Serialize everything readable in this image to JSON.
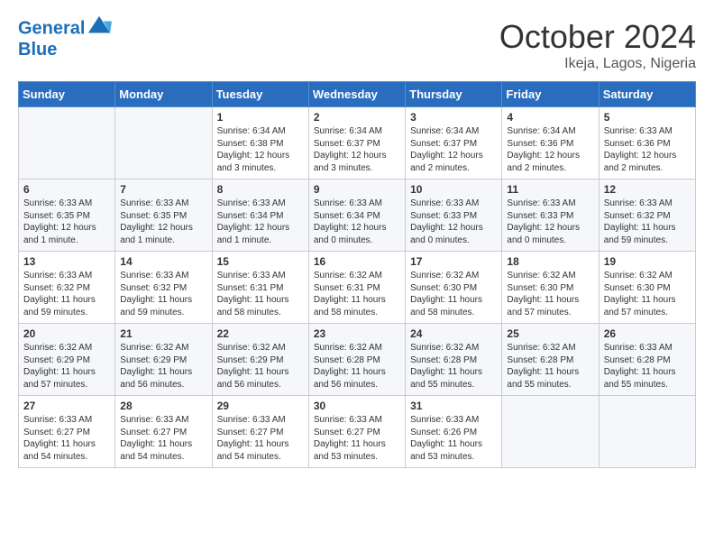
{
  "header": {
    "logo_line1": "General",
    "logo_line2": "Blue",
    "month": "October 2024",
    "location": "Ikeja, Lagos, Nigeria"
  },
  "days_of_week": [
    "Sunday",
    "Monday",
    "Tuesday",
    "Wednesday",
    "Thursday",
    "Friday",
    "Saturday"
  ],
  "weeks": [
    [
      {
        "day": "",
        "sunrise": "",
        "sunset": "",
        "daylight": ""
      },
      {
        "day": "",
        "sunrise": "",
        "sunset": "",
        "daylight": ""
      },
      {
        "day": "1",
        "sunrise": "Sunrise: 6:34 AM",
        "sunset": "Sunset: 6:38 PM",
        "daylight": "Daylight: 12 hours and 3 minutes."
      },
      {
        "day": "2",
        "sunrise": "Sunrise: 6:34 AM",
        "sunset": "Sunset: 6:37 PM",
        "daylight": "Daylight: 12 hours and 3 minutes."
      },
      {
        "day": "3",
        "sunrise": "Sunrise: 6:34 AM",
        "sunset": "Sunset: 6:37 PM",
        "daylight": "Daylight: 12 hours and 2 minutes."
      },
      {
        "day": "4",
        "sunrise": "Sunrise: 6:34 AM",
        "sunset": "Sunset: 6:36 PM",
        "daylight": "Daylight: 12 hours and 2 minutes."
      },
      {
        "day": "5",
        "sunrise": "Sunrise: 6:33 AM",
        "sunset": "Sunset: 6:36 PM",
        "daylight": "Daylight: 12 hours and 2 minutes."
      }
    ],
    [
      {
        "day": "6",
        "sunrise": "Sunrise: 6:33 AM",
        "sunset": "Sunset: 6:35 PM",
        "daylight": "Daylight: 12 hours and 1 minute."
      },
      {
        "day": "7",
        "sunrise": "Sunrise: 6:33 AM",
        "sunset": "Sunset: 6:35 PM",
        "daylight": "Daylight: 12 hours and 1 minute."
      },
      {
        "day": "8",
        "sunrise": "Sunrise: 6:33 AM",
        "sunset": "Sunset: 6:34 PM",
        "daylight": "Daylight: 12 hours and 1 minute."
      },
      {
        "day": "9",
        "sunrise": "Sunrise: 6:33 AM",
        "sunset": "Sunset: 6:34 PM",
        "daylight": "Daylight: 12 hours and 0 minutes."
      },
      {
        "day": "10",
        "sunrise": "Sunrise: 6:33 AM",
        "sunset": "Sunset: 6:33 PM",
        "daylight": "Daylight: 12 hours and 0 minutes."
      },
      {
        "day": "11",
        "sunrise": "Sunrise: 6:33 AM",
        "sunset": "Sunset: 6:33 PM",
        "daylight": "Daylight: 12 hours and 0 minutes."
      },
      {
        "day": "12",
        "sunrise": "Sunrise: 6:33 AM",
        "sunset": "Sunset: 6:32 PM",
        "daylight": "Daylight: 11 hours and 59 minutes."
      }
    ],
    [
      {
        "day": "13",
        "sunrise": "Sunrise: 6:33 AM",
        "sunset": "Sunset: 6:32 PM",
        "daylight": "Daylight: 11 hours and 59 minutes."
      },
      {
        "day": "14",
        "sunrise": "Sunrise: 6:33 AM",
        "sunset": "Sunset: 6:32 PM",
        "daylight": "Daylight: 11 hours and 59 minutes."
      },
      {
        "day": "15",
        "sunrise": "Sunrise: 6:33 AM",
        "sunset": "Sunset: 6:31 PM",
        "daylight": "Daylight: 11 hours and 58 minutes."
      },
      {
        "day": "16",
        "sunrise": "Sunrise: 6:32 AM",
        "sunset": "Sunset: 6:31 PM",
        "daylight": "Daylight: 11 hours and 58 minutes."
      },
      {
        "day": "17",
        "sunrise": "Sunrise: 6:32 AM",
        "sunset": "Sunset: 6:30 PM",
        "daylight": "Daylight: 11 hours and 58 minutes."
      },
      {
        "day": "18",
        "sunrise": "Sunrise: 6:32 AM",
        "sunset": "Sunset: 6:30 PM",
        "daylight": "Daylight: 11 hours and 57 minutes."
      },
      {
        "day": "19",
        "sunrise": "Sunrise: 6:32 AM",
        "sunset": "Sunset: 6:30 PM",
        "daylight": "Daylight: 11 hours and 57 minutes."
      }
    ],
    [
      {
        "day": "20",
        "sunrise": "Sunrise: 6:32 AM",
        "sunset": "Sunset: 6:29 PM",
        "daylight": "Daylight: 11 hours and 57 minutes."
      },
      {
        "day": "21",
        "sunrise": "Sunrise: 6:32 AM",
        "sunset": "Sunset: 6:29 PM",
        "daylight": "Daylight: 11 hours and 56 minutes."
      },
      {
        "day": "22",
        "sunrise": "Sunrise: 6:32 AM",
        "sunset": "Sunset: 6:29 PM",
        "daylight": "Daylight: 11 hours and 56 minutes."
      },
      {
        "day": "23",
        "sunrise": "Sunrise: 6:32 AM",
        "sunset": "Sunset: 6:28 PM",
        "daylight": "Daylight: 11 hours and 56 minutes."
      },
      {
        "day": "24",
        "sunrise": "Sunrise: 6:32 AM",
        "sunset": "Sunset: 6:28 PM",
        "daylight": "Daylight: 11 hours and 55 minutes."
      },
      {
        "day": "25",
        "sunrise": "Sunrise: 6:32 AM",
        "sunset": "Sunset: 6:28 PM",
        "daylight": "Daylight: 11 hours and 55 minutes."
      },
      {
        "day": "26",
        "sunrise": "Sunrise: 6:33 AM",
        "sunset": "Sunset: 6:28 PM",
        "daylight": "Daylight: 11 hours and 55 minutes."
      }
    ],
    [
      {
        "day": "27",
        "sunrise": "Sunrise: 6:33 AM",
        "sunset": "Sunset: 6:27 PM",
        "daylight": "Daylight: 11 hours and 54 minutes."
      },
      {
        "day": "28",
        "sunrise": "Sunrise: 6:33 AM",
        "sunset": "Sunset: 6:27 PM",
        "daylight": "Daylight: 11 hours and 54 minutes."
      },
      {
        "day": "29",
        "sunrise": "Sunrise: 6:33 AM",
        "sunset": "Sunset: 6:27 PM",
        "daylight": "Daylight: 11 hours and 54 minutes."
      },
      {
        "day": "30",
        "sunrise": "Sunrise: 6:33 AM",
        "sunset": "Sunset: 6:27 PM",
        "daylight": "Daylight: 11 hours and 53 minutes."
      },
      {
        "day": "31",
        "sunrise": "Sunrise: 6:33 AM",
        "sunset": "Sunset: 6:26 PM",
        "daylight": "Daylight: 11 hours and 53 minutes."
      },
      {
        "day": "",
        "sunrise": "",
        "sunset": "",
        "daylight": ""
      },
      {
        "day": "",
        "sunrise": "",
        "sunset": "",
        "daylight": ""
      }
    ]
  ]
}
